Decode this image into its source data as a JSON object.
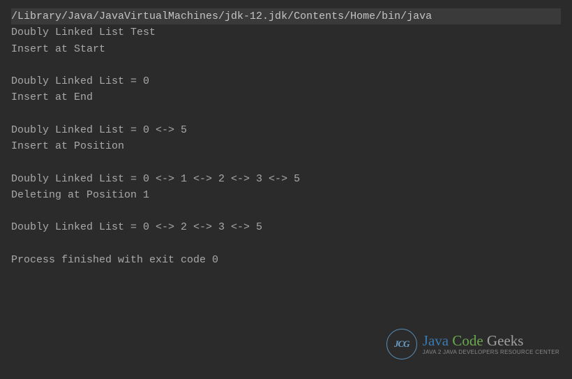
{
  "console": {
    "lines": [
      {
        "text": "/Library/Java/JavaVirtualMachines/jdk-12.jdk/Contents/Home/bin/java",
        "highlight": true
      },
      {
        "text": "Doubly Linked List Test"
      },
      {
        "text": "Insert at Start"
      },
      {
        "text": ""
      },
      {
        "text": "Doubly Linked List = 0"
      },
      {
        "text": "Insert at End"
      },
      {
        "text": ""
      },
      {
        "text": "Doubly Linked List = 0 <-> 5"
      },
      {
        "text": "Insert at Position"
      },
      {
        "text": ""
      },
      {
        "text": "Doubly Linked List = 0 <-> 1 <-> 2 <-> 3 <-> 5"
      },
      {
        "text": "Deleting at Position 1"
      },
      {
        "text": ""
      },
      {
        "text": "Doubly Linked List = 0 <-> 2 <-> 3 <-> 5"
      },
      {
        "text": ""
      },
      {
        "text": "Process finished with exit code 0"
      }
    ]
  },
  "watermark": {
    "badge": "JCG",
    "java": "Java",
    "code": "Code",
    "geeks": "Geeks",
    "tagline": "Java 2 Java Developers Resource Center"
  }
}
